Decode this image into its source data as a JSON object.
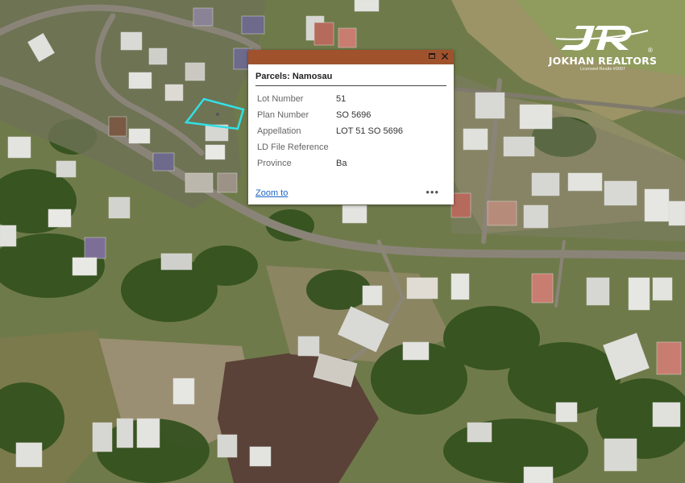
{
  "popup": {
    "title": "Parcels: Namosau",
    "rows": [
      {
        "key": "Lot Number",
        "value": "51"
      },
      {
        "key": "Plan Number",
        "value": "SO 5696"
      },
      {
        "key": "Appellation",
        "value": "LOT 51 SO 5696"
      },
      {
        "key": "LD File Reference",
        "value": ""
      },
      {
        "key": "Province",
        "value": "Ba"
      }
    ],
    "zoom_label": "Zoom to",
    "more_label": "•••",
    "close_label": "✕",
    "header_color": "#a0522d"
  },
  "logo": {
    "name": "JOKHAN REALTORS",
    "tagline": "Licensed Realts #0007",
    "registered_mark": "®"
  },
  "map": {
    "highlight_color": "#32e0e6"
  }
}
